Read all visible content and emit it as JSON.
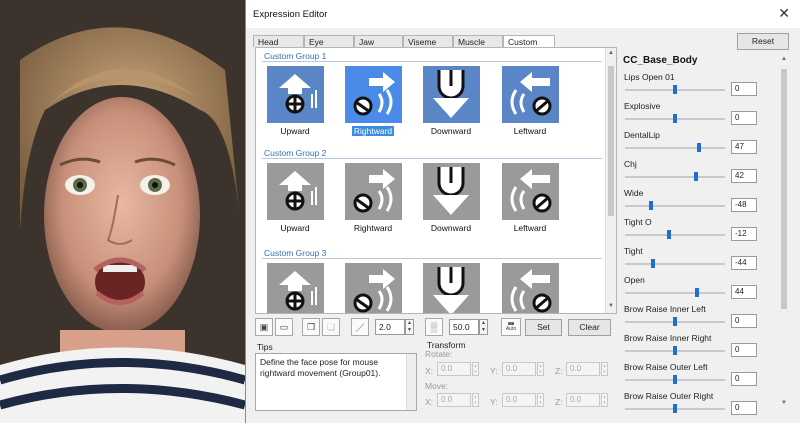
{
  "window": {
    "title": "Expression Editor",
    "close_glyph": "✕"
  },
  "tabs": [
    {
      "label": "Head",
      "active": false
    },
    {
      "label": "Eye",
      "active": false
    },
    {
      "label": "Jaw",
      "active": false
    },
    {
      "label": "Viseme",
      "active": false
    },
    {
      "label": "Muscle",
      "active": false
    },
    {
      "label": "Custom",
      "active": true
    }
  ],
  "groups": [
    {
      "title": "Custom Group 1",
      "style": "blue",
      "items": [
        {
          "label": "Upward",
          "icon": "upward-icon",
          "selected": false
        },
        {
          "label": "Rightward",
          "icon": "rightward-icon",
          "selected": true
        },
        {
          "label": "Downward",
          "icon": "downward-icon",
          "selected": false
        },
        {
          "label": "Leftward",
          "icon": "leftward-icon",
          "selected": false
        }
      ]
    },
    {
      "title": "Custom Group 2",
      "style": "gray",
      "items": [
        {
          "label": "Upward",
          "icon": "upward-icon",
          "selected": false
        },
        {
          "label": "Rightward",
          "icon": "rightward-icon",
          "selected": false
        },
        {
          "label": "Downward",
          "icon": "downward-icon",
          "selected": false
        },
        {
          "label": "Leftward",
          "icon": "leftward-icon",
          "selected": false
        }
      ]
    },
    {
      "title": "Custom Group 3",
      "style": "gray",
      "items": [
        {
          "label": "",
          "icon": "upward-icon",
          "selected": false
        },
        {
          "label": "",
          "icon": "rightward-icon",
          "selected": false
        },
        {
          "label": "",
          "icon": "downward-icon",
          "selected": false
        },
        {
          "label": "",
          "icon": "leftward-icon",
          "selected": false
        }
      ]
    }
  ],
  "toolbar": {
    "brush_size": "2.0",
    "strength": "50.0",
    "auto_label": "Auto",
    "set_label": "Set",
    "clear_label": "Clear"
  },
  "tips": {
    "label": "Tips",
    "text": "Define the face pose for mouse rightward movement (Group01)."
  },
  "transform": {
    "label": "Transform",
    "rotate_label": "Rotate:",
    "move_label": "Move:",
    "x_label": "X:",
    "y_label": "Y:",
    "z_label": "Z:",
    "rotate": {
      "x": "0.0",
      "y": "0.0",
      "z": "0.0"
    },
    "move": {
      "x": "0.0",
      "y": "0.0",
      "z": "0.0"
    }
  },
  "right_panel": {
    "reset_label": "Reset",
    "mesh_title": "CC_Base_Body",
    "sliders": [
      {
        "label": "Lips Open 01",
        "value": "0",
        "level": 0.5
      },
      {
        "label": "Explosive",
        "value": "0",
        "level": 0.5
      },
      {
        "label": "DentalLip",
        "value": "47",
        "level": 0.735
      },
      {
        "label": "Chj",
        "value": "42",
        "level": 0.71
      },
      {
        "label": "Wide",
        "value": "-48",
        "level": 0.26
      },
      {
        "label": "Tight O",
        "value": "-12",
        "level": 0.44
      },
      {
        "label": "Tight",
        "value": "-44",
        "level": 0.28
      },
      {
        "label": "Open",
        "value": "44",
        "level": 0.72
      },
      {
        "label": "Brow Raise Inner Left",
        "value": "0",
        "level": 0.5
      },
      {
        "label": "Brow Raise Inner Right",
        "value": "0",
        "level": 0.5
      },
      {
        "label": "Brow Raise Outer Left",
        "value": "0",
        "level": 0.5
      },
      {
        "label": "Brow Raise Outer Right",
        "value": "0",
        "level": 0.5
      }
    ]
  },
  "colors": {
    "tile_blue": "#5a86c8",
    "tile_gray": "#9a9a9a",
    "group_title": "#3a6fb0",
    "slider_thumb": "#1f6fd1",
    "selection": "#3c8ce0"
  }
}
